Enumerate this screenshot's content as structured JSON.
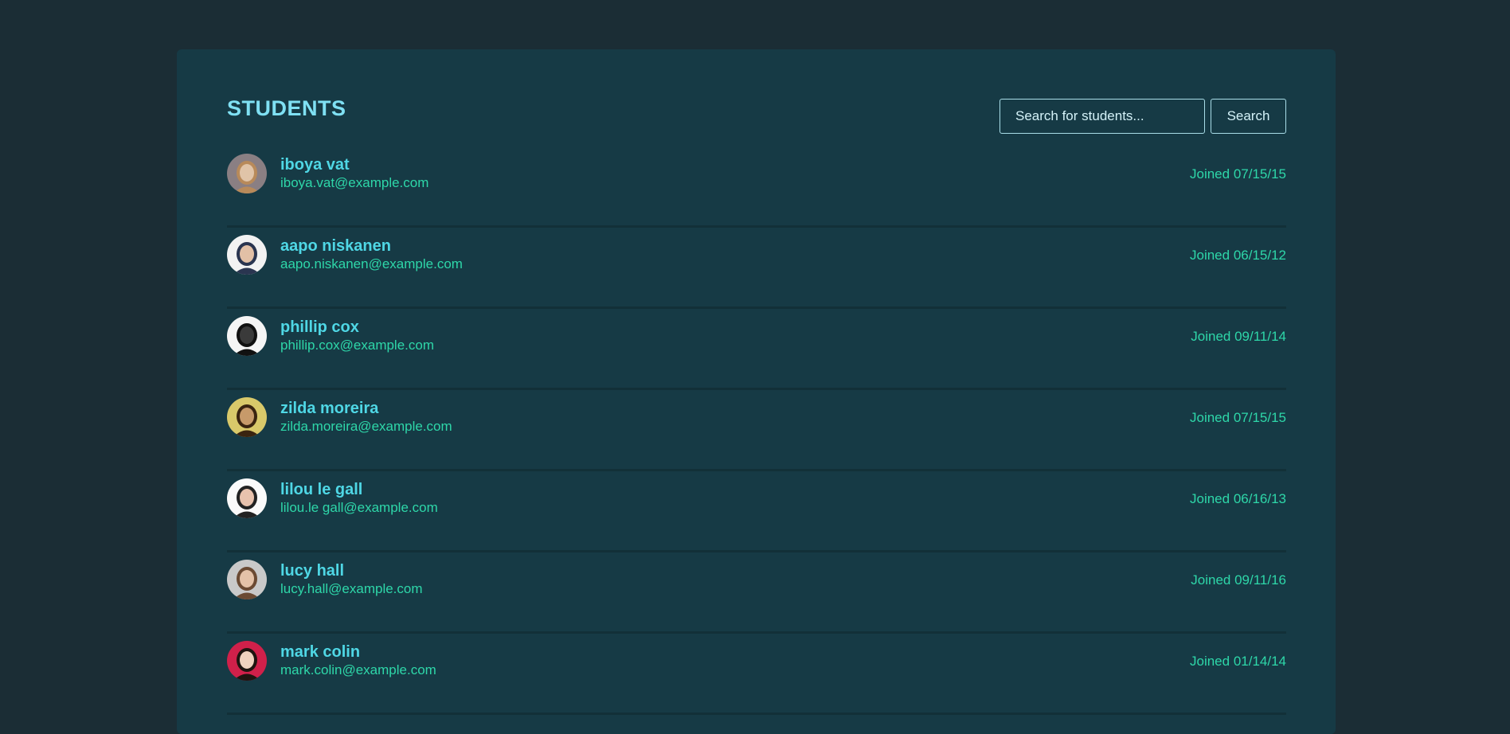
{
  "page": {
    "title": "STUDENTS"
  },
  "search": {
    "placeholder": "Search for students...",
    "button_label": "Search"
  },
  "students": [
    {
      "name": "iboya vat",
      "email": "iboya.vat@example.com",
      "joined": "Joined 07/15/15",
      "avatar_bg": "#8a7f83",
      "avatar_fg": "#e0c4a8",
      "avatar_hair": "#b88a5a"
    },
    {
      "name": "aapo niskanen",
      "email": "aapo.niskanen@example.com",
      "joined": "Joined 06/15/12",
      "avatar_bg": "#f2f2f2",
      "avatar_fg": "#e2c0a6",
      "avatar_hair": "#2a3550"
    },
    {
      "name": "phillip cox",
      "email": "phillip.cox@example.com",
      "joined": "Joined 09/11/14",
      "avatar_bg": "#f5f5f5",
      "avatar_fg": "#3a3a3a",
      "avatar_hair": "#111111"
    },
    {
      "name": "zilda moreira",
      "email": "zilda.moreira@example.com",
      "joined": "Joined 07/15/15",
      "avatar_bg": "#d9c96a",
      "avatar_fg": "#c79a6a",
      "avatar_hair": "#3a2410"
    },
    {
      "name": "lilou le gall",
      "email": "lilou.le gall@example.com",
      "joined": "Joined 06/16/13",
      "avatar_bg": "#fafafa",
      "avatar_fg": "#e8c2ad",
      "avatar_hair": "#222222"
    },
    {
      "name": "lucy hall",
      "email": "lucy.hall@example.com",
      "joined": "Joined 09/11/16",
      "avatar_bg": "#c9c9c9",
      "avatar_fg": "#e4c2a8",
      "avatar_hair": "#6b4a33"
    },
    {
      "name": "mark colin",
      "email": "mark.colin@example.com",
      "joined": "Joined 01/14/14",
      "avatar_bg": "#d0204a",
      "avatar_fg": "#f0d2bf",
      "avatar_hair": "#1f1410"
    }
  ]
}
